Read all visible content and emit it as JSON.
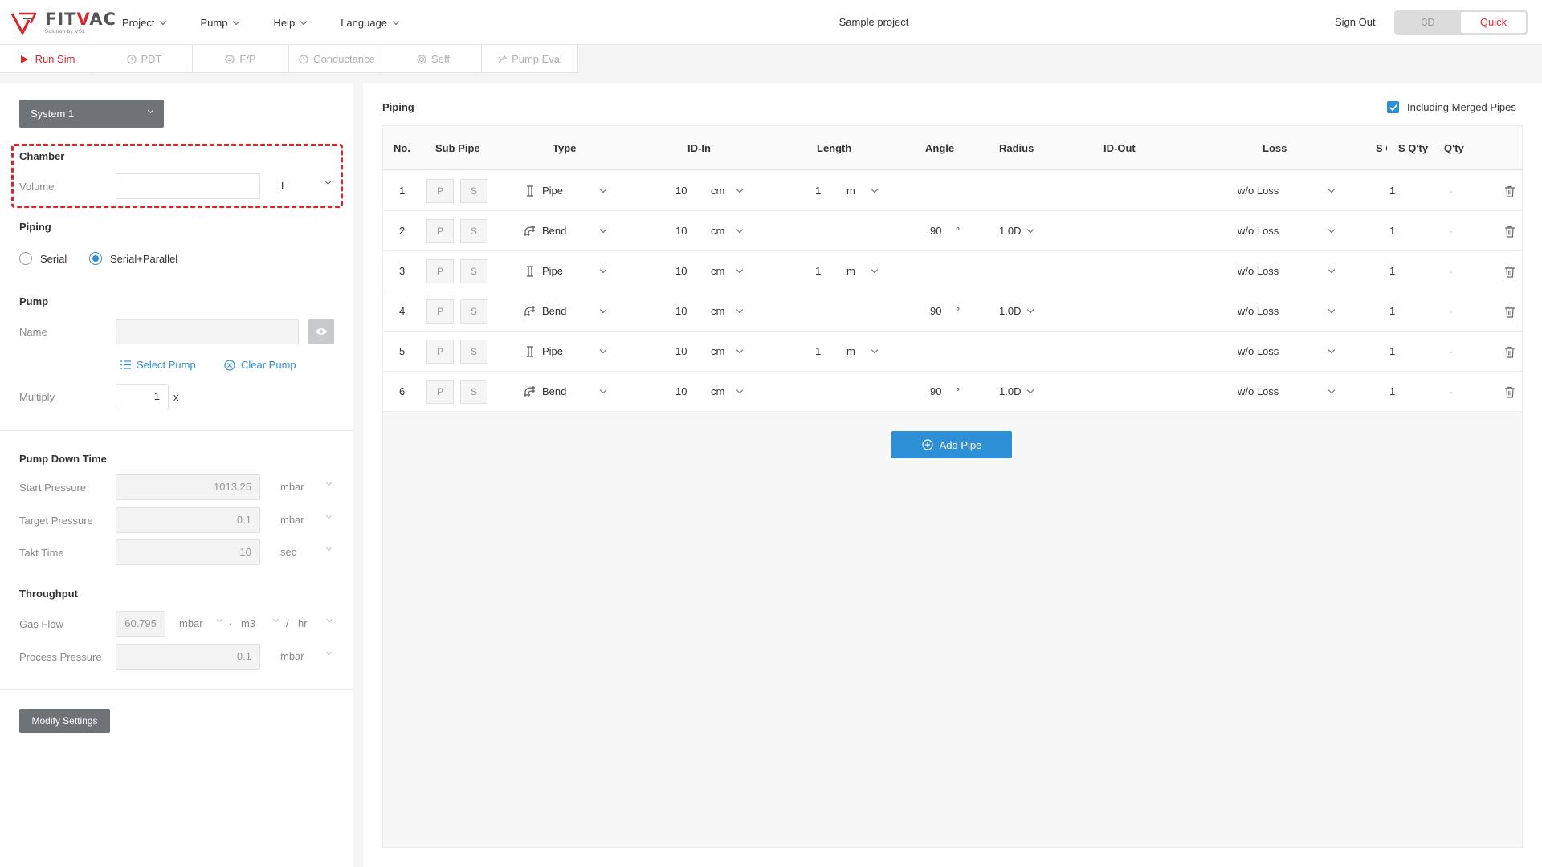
{
  "app": {
    "logo_text": "FITVAC",
    "logo_sub": "Solution by VSL",
    "project_title": "Sample project",
    "sign_out": "Sign Out",
    "mode_3d": "3D",
    "mode_quick": "Quick",
    "accent_color": "#d6262e",
    "primary_color": "#2d8fd5"
  },
  "menu": [
    {
      "label": "Project"
    },
    {
      "label": "Pump"
    },
    {
      "label": "Help"
    },
    {
      "label": "Language"
    }
  ],
  "toolbar": {
    "run_sim": "Run Sim",
    "pdt": "PDT",
    "fp": "F/P",
    "conductance": "Conductance",
    "seff": "Seff",
    "pump_eval": "Pump Eval"
  },
  "left": {
    "system_select": "System 1",
    "chamber": {
      "title": "Chamber",
      "volume_label": "Volume",
      "volume_value": "",
      "volume_unit": "L"
    },
    "piping": {
      "title": "Piping",
      "serial": "Serial",
      "serial_parallel": "Serial+Parallel",
      "selected": "Serial+Parallel"
    },
    "pump": {
      "title": "Pump",
      "name_label": "Name",
      "name_value": "",
      "select_pump": "Select Pump",
      "clear_pump": "Clear Pump",
      "multiply_label": "Multiply",
      "multiply_value": "1",
      "multiply_suffix": "x"
    },
    "pdt": {
      "title": "Pump Down Time",
      "start_label": "Start Pressure",
      "start_value": "1013.25",
      "start_unit": "mbar",
      "target_label": "Target Pressure",
      "target_value": "0.1",
      "target_unit": "mbar",
      "takt_label": "Takt Time",
      "takt_value": "10",
      "takt_unit": "sec"
    },
    "throughput": {
      "title": "Throughput",
      "gas_label": "Gas Flow",
      "gas_value": "60.795",
      "gas_unit1": "mbar",
      "gas_sep": "·",
      "gas_unit2": "m3",
      "gas_slash": "/",
      "gas_unit3": "hr",
      "process_label": "Process Pressure",
      "process_value": "0.1",
      "process_unit": "mbar"
    },
    "modify_settings": "Modify Settings"
  },
  "piping_table": {
    "title": "Piping",
    "including_merged": "Including Merged Pipes",
    "including_merged_checked": true,
    "headers": {
      "no": "No.",
      "sub_pipe": "Sub Pipe",
      "type": "Type",
      "id_in": "ID-In",
      "length": "Length",
      "angle": "Angle",
      "radius": "Radius",
      "id_out": "ID-Out",
      "loss": "Loss",
      "s_clip": "S Q",
      "s_qty": "S Q'ty",
      "qty": "Q'ty"
    },
    "sub_p": "P",
    "sub_s": "S",
    "rows": [
      {
        "no": "1",
        "type": "Pipe",
        "id_in": "10",
        "id_unit": "cm",
        "length": "1",
        "length_unit": "m",
        "angle": "",
        "angle_unit": "",
        "radius": "",
        "loss": "w/o Loss",
        "s_qty": "1",
        "qty": "-"
      },
      {
        "no": "2",
        "type": "Bend",
        "id_in": "10",
        "id_unit": "cm",
        "length": "",
        "length_unit": "",
        "angle": "90",
        "angle_unit": "°",
        "radius": "1.0D",
        "loss": "w/o Loss",
        "s_qty": "1",
        "qty": "-"
      },
      {
        "no": "3",
        "type": "Pipe",
        "id_in": "10",
        "id_unit": "cm",
        "length": "1",
        "length_unit": "m",
        "angle": "",
        "angle_unit": "",
        "radius": "",
        "loss": "w/o Loss",
        "s_qty": "1",
        "qty": "-"
      },
      {
        "no": "4",
        "type": "Bend",
        "id_in": "10",
        "id_unit": "cm",
        "length": "",
        "length_unit": "",
        "angle": "90",
        "angle_unit": "°",
        "radius": "1.0D",
        "loss": "w/o Loss",
        "s_qty": "1",
        "qty": "-"
      },
      {
        "no": "5",
        "type": "Pipe",
        "id_in": "10",
        "id_unit": "cm",
        "length": "1",
        "length_unit": "m",
        "angle": "",
        "angle_unit": "",
        "radius": "",
        "loss": "w/o Loss",
        "s_qty": "1",
        "qty": "-"
      },
      {
        "no": "6",
        "type": "Bend",
        "id_in": "10",
        "id_unit": "cm",
        "length": "",
        "length_unit": "",
        "angle": "90",
        "angle_unit": "°",
        "radius": "1.0D",
        "loss": "w/o Loss",
        "s_qty": "1",
        "qty": "-"
      }
    ],
    "add_pipe": "Add Pipe"
  }
}
